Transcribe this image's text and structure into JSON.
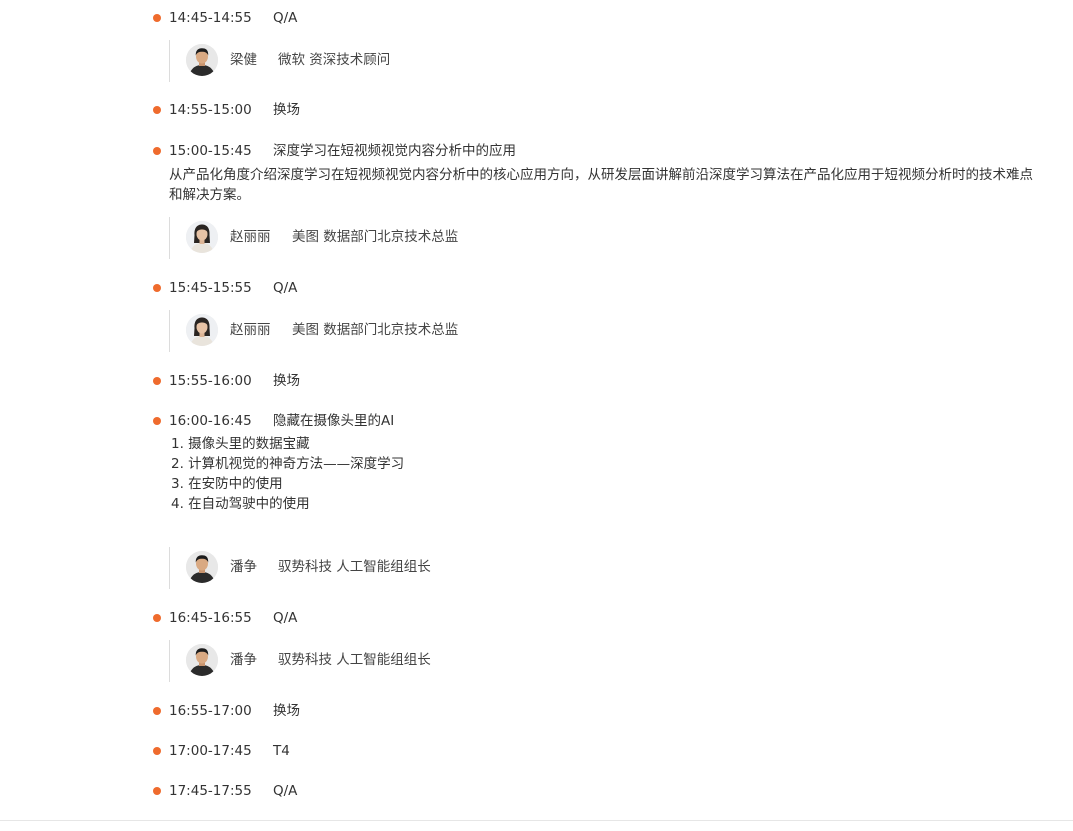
{
  "colors": {
    "accent_dot": "#ef6b2d",
    "text": "#333333",
    "divider": "#dcdcdc"
  },
  "schedule": [
    {
      "time": "14:45-14:55",
      "title": "Q/A",
      "speakers": [
        {
          "name": "梁健",
          "org": "微软 资深技术顾问",
          "avatar": "male-avatar"
        }
      ]
    },
    {
      "time": "14:55-15:00",
      "title": "换场"
    },
    {
      "time": "15:00-15:45",
      "title": "深度学习在短视频视觉内容分析中的应用",
      "description_lines": [
        "从产品化角度介绍深度学习在短视频视觉内容分析中的核心应用方向，从研发层面讲解前沿深度学习算法在产品化应用于短视频分析时的技术难点",
        "和解决方案。"
      ],
      "speakers": [
        {
          "name": "赵丽丽",
          "org": "美图 数据部门北京技术总监",
          "avatar": "female-avatar"
        }
      ]
    },
    {
      "time": "15:45-15:55",
      "title": "Q/A",
      "speakers": [
        {
          "name": "赵丽丽",
          "org": "美图 数据部门北京技术总监",
          "avatar": "female-avatar"
        }
      ]
    },
    {
      "time": "15:55-16:00",
      "title": "换场"
    },
    {
      "time": "16:00-16:45",
      "title": "隐藏在摄像头里的AI",
      "list": [
        "1. 摄像头里的数据宝藏",
        "2. 计算机视觉的神奇方法——深度学习",
        "3. 在安防中的使用",
        "4. 在自动驾驶中的使用"
      ],
      "speakers": [
        {
          "name": "潘争",
          "org": "驭势科技 人工智能组组长",
          "avatar": "male-avatar"
        }
      ]
    },
    {
      "time": "16:45-16:55",
      "title": "Q/A",
      "speakers": [
        {
          "name": "潘争",
          "org": "驭势科技 人工智能组组长",
          "avatar": "male-avatar"
        }
      ]
    },
    {
      "time": "16:55-17:00",
      "title": "换场"
    },
    {
      "time": "17:00-17:45",
      "title": "T4"
    },
    {
      "time": "17:45-17:55",
      "title": "Q/A"
    }
  ]
}
